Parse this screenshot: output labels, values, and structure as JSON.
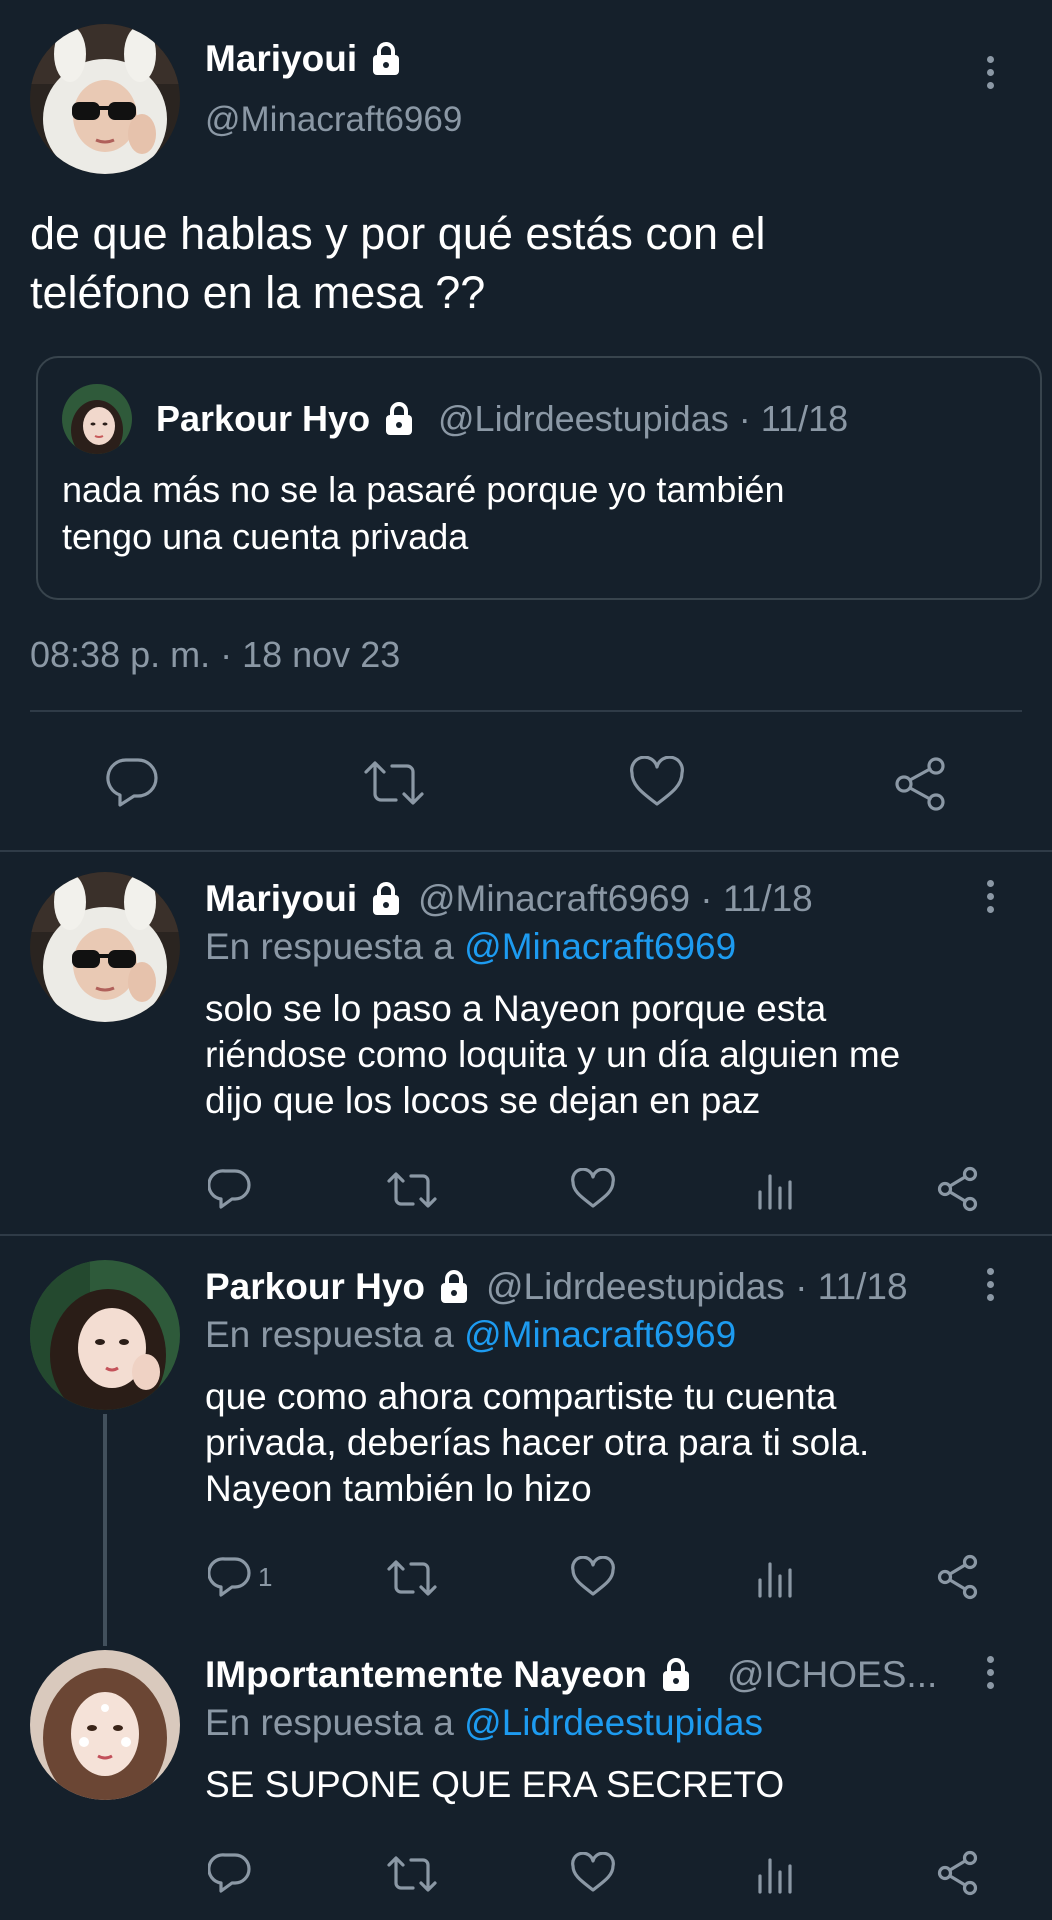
{
  "main_tweet": {
    "display_name": "Mariyoui",
    "handle": "@Minacraft6969",
    "text_line1": "de que hablas y por qué estás con el",
    "text_line2": "teléfono en la mesa ??",
    "quote": {
      "display_name": "Parkour Hyo",
      "handle_date": "@Lidrdeestupidas · 11/18",
      "text_line1": "nada más no se la pasaré porque yo también",
      "text_line2": "tengo una cuenta privada"
    },
    "timestamp": "08:38 p. m. · 18 nov 23"
  },
  "replies": [
    {
      "display_name": "Mariyoui",
      "handle_date": "@Minacraft6969 · 11/18",
      "reply_prefix": "En respuesta a",
      "reply_to": "@Minacraft6969",
      "lines": [
        "solo se lo paso a Nayeon porque esta",
        "riéndose como loquita y un día alguien me",
        "dijo que los locos se dejan en paz"
      ],
      "reply_count": ""
    },
    {
      "display_name": "Parkour Hyo",
      "handle_date": "@Lidrdeestupidas · 11/18",
      "reply_prefix": "En respuesta a",
      "reply_to": "@Minacraft6969",
      "lines": [
        "que como ahora compartiste tu cuenta",
        "privada, deberías hacer otra para ti sola.",
        "Nayeon también lo hizo"
      ],
      "reply_count": "1"
    },
    {
      "display_name": "IMportantemente Nayeon",
      "handle_date": "@ICHOES...",
      "reply_prefix": "En respuesta a",
      "reply_to": "@Lidrdeestupidas",
      "lines": [
        "SE SUPONE QUE ERA SECRETO"
      ],
      "reply_count": ""
    }
  ],
  "colors": {
    "background": "#15202b",
    "muted_text": "#8b98a5",
    "link": "#1d9bf0",
    "divider": "#2f3b47"
  },
  "icons": [
    "lock-icon",
    "more-options-icon",
    "reply-icon",
    "retweet-icon",
    "like-icon",
    "analytics-icon",
    "share-icon"
  ]
}
